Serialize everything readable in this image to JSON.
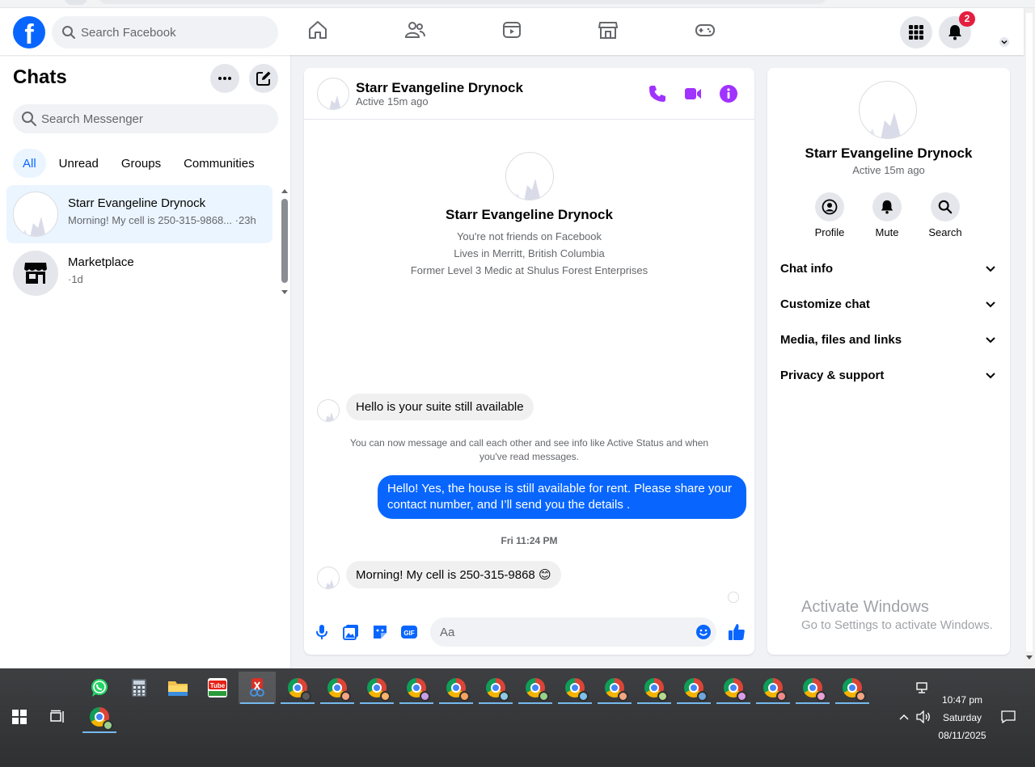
{
  "facebook": {
    "logo": "f",
    "search_placeholder": "Search Facebook",
    "nav_tabs": [
      "home-icon",
      "friends-icon",
      "video-icon",
      "marketplace-icon",
      "gaming-icon"
    ],
    "notification_count": "2"
  },
  "chats": {
    "title": "Chats",
    "search_placeholder": "Search Messenger",
    "filters": [
      "All",
      "Unread",
      "Groups",
      "Communities"
    ],
    "active_filter": "All",
    "items": [
      {
        "name": "Starr Evangeline Drynock",
        "preview": "Morning! My cell is 250-315-9868... ·23h"
      },
      {
        "name": "Marketplace",
        "preview": "·1d"
      }
    ]
  },
  "conversation": {
    "name": "Starr Evangeline Drynock",
    "status": "Active 15m ago",
    "profile_lines": [
      "You're not friends on Facebook",
      "Lives in Merritt, British Columbia",
      "Former Level 3 Medic at Shulus Forest Enterprises"
    ],
    "messages": [
      {
        "from": "them",
        "text": "Hello is your suite still available"
      },
      {
        "from": "system",
        "text": "You can now message and call each other and see info like Active Status and when you've read messages."
      },
      {
        "from": "me",
        "text": "Hello! Yes, the house is still available for rent. Please share your contact number, and I’ll send you the details ."
      },
      {
        "from": "time",
        "text": "Fri 11:24 PM"
      },
      {
        "from": "them",
        "text": "Morning! My cell is 250-315-9868 😊"
      }
    ],
    "composer_placeholder": "Aa"
  },
  "info_panel": {
    "name": "Starr Evangeline Drynock",
    "status": "Active 15m ago",
    "actions": [
      "Profile",
      "Mute",
      "Search"
    ],
    "sections": [
      "Chat info",
      "Customize chat",
      "Media, files and links",
      "Privacy & support"
    ]
  },
  "watermark": {
    "title": "Activate Windows",
    "subtitle": "Go to Settings to activate Windows."
  },
  "taskbar": {
    "time": "10:47 pm",
    "day": "Saturday",
    "date": "08/11/2025"
  },
  "colors": {
    "brand": "#0866ff",
    "messenger_accent": "#a033ff",
    "badge": "#e41e3f"
  }
}
